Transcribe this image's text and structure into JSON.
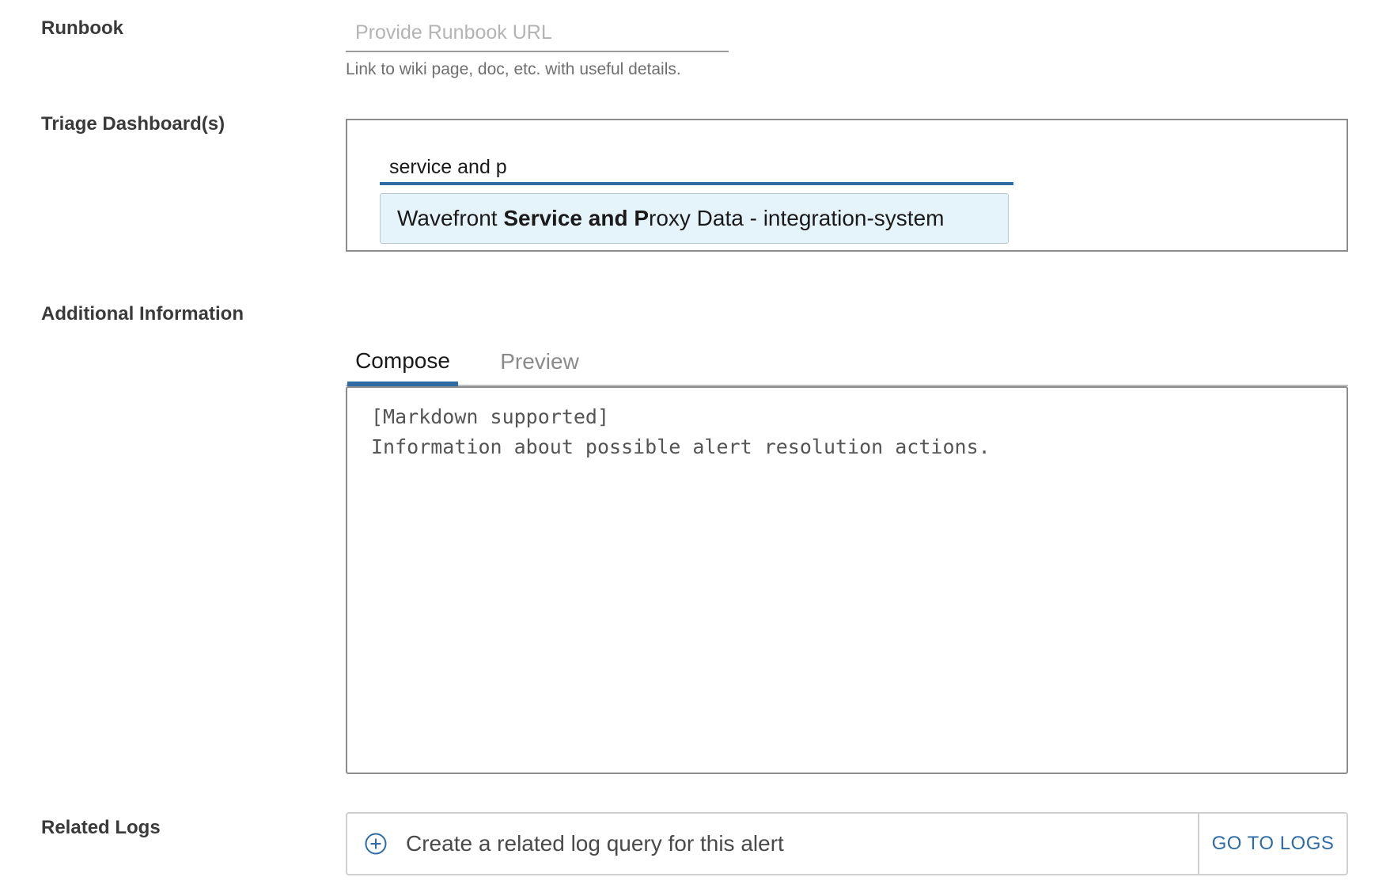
{
  "runbook": {
    "label": "Runbook",
    "placeholder": "Provide Runbook URL",
    "helper": "Link to wiki page, doc, etc. with useful details."
  },
  "triage": {
    "label": "Triage Dashboard(s)",
    "input_value": "service and p",
    "suggestion": {
      "prefix": "Wavefront ",
      "match_bold": "Service and P",
      "suffix": "roxy Data - integration-system"
    }
  },
  "additional": {
    "label": "Additional Information",
    "tabs": [
      {
        "label": "Compose",
        "active": true
      },
      {
        "label": "Preview",
        "active": false
      }
    ],
    "placeholder": "[Markdown supported]\nInformation about possible alert resolution actions."
  },
  "logs": {
    "label": "Related Logs",
    "create_text": "Create a related log query for this alert",
    "go_button": "GO TO LOGS",
    "icon": "plus-circle-icon"
  },
  "colors": {
    "accent": "#2f6ca6",
    "suggestion_bg": "#e5f3fb"
  }
}
